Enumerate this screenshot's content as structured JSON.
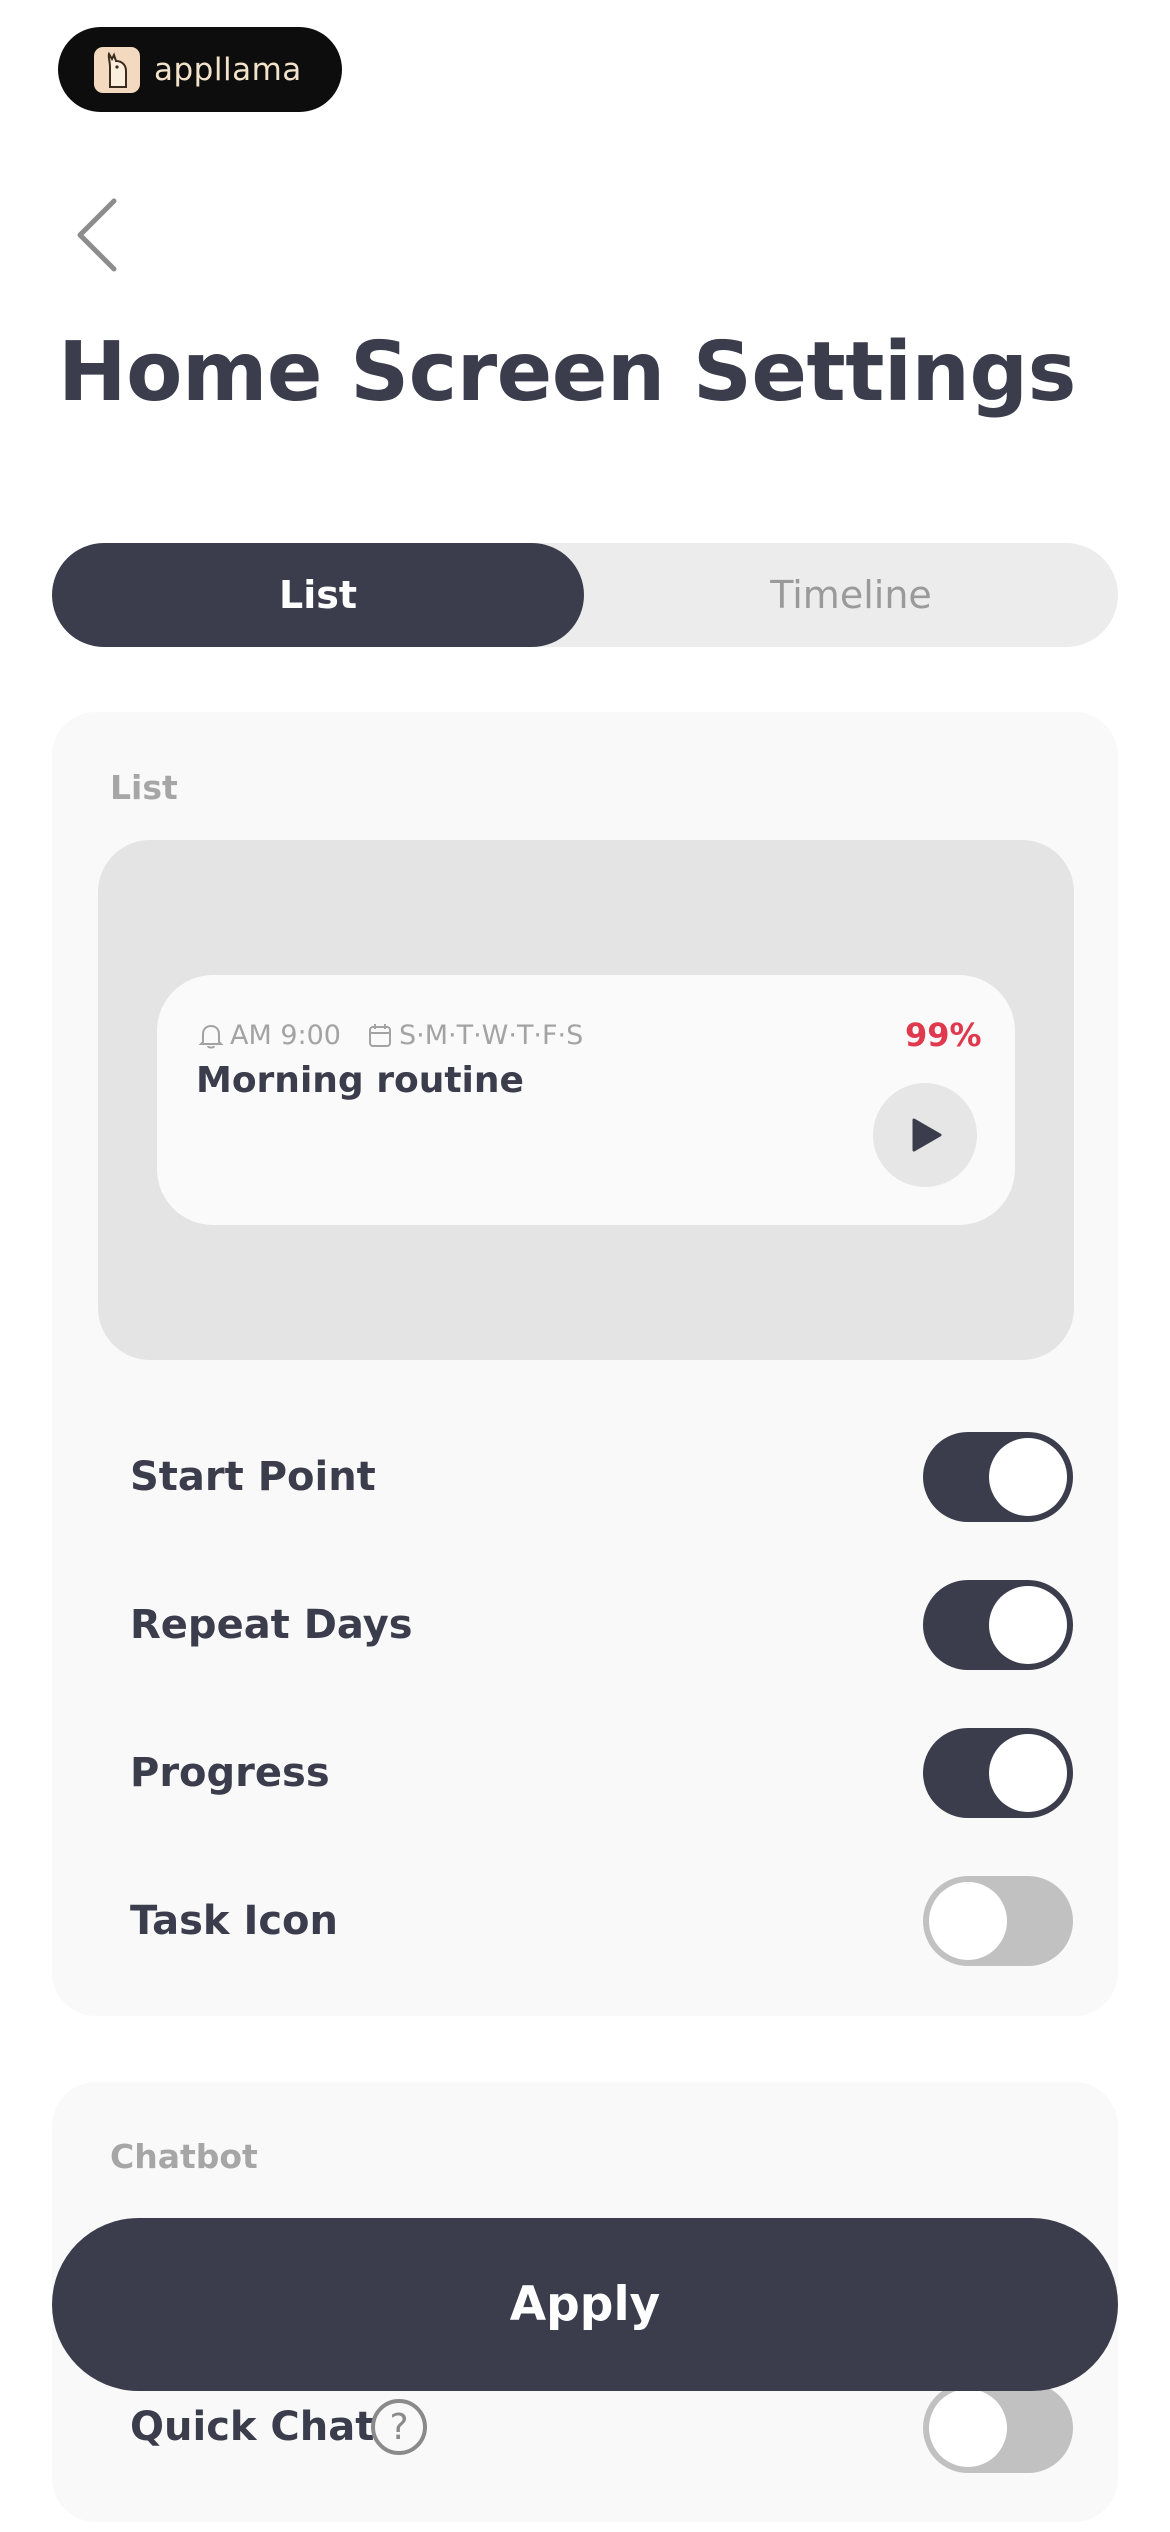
{
  "brand": {
    "name": "appllama"
  },
  "page": {
    "title": "Home Screen Settings"
  },
  "tabs": [
    {
      "label": "List",
      "selected": true
    },
    {
      "label": "Timeline",
      "selected": false
    }
  ],
  "list_section": {
    "label": "List",
    "preview": {
      "time": "AM 9:00",
      "days": "S·M·T·W·T·F·S",
      "progress_text": "99%",
      "task_name": "Morning routine"
    },
    "options": [
      {
        "label": "Start Point",
        "enabled": true
      },
      {
        "label": "Repeat Days",
        "enabled": true
      },
      {
        "label": "Progress",
        "enabled": true
      },
      {
        "label": "Task Icon",
        "enabled": false
      }
    ]
  },
  "chatbot_section": {
    "label": "Chatbot",
    "options": [
      {
        "label": "Quick Chat",
        "enabled": false,
        "help_icon": "question-circle-icon"
      }
    ]
  },
  "apply_button": {
    "label": "Apply"
  },
  "colors": {
    "primary": "#3b3d4c",
    "accent": "#e0394e",
    "card": "#f9f9f9"
  }
}
